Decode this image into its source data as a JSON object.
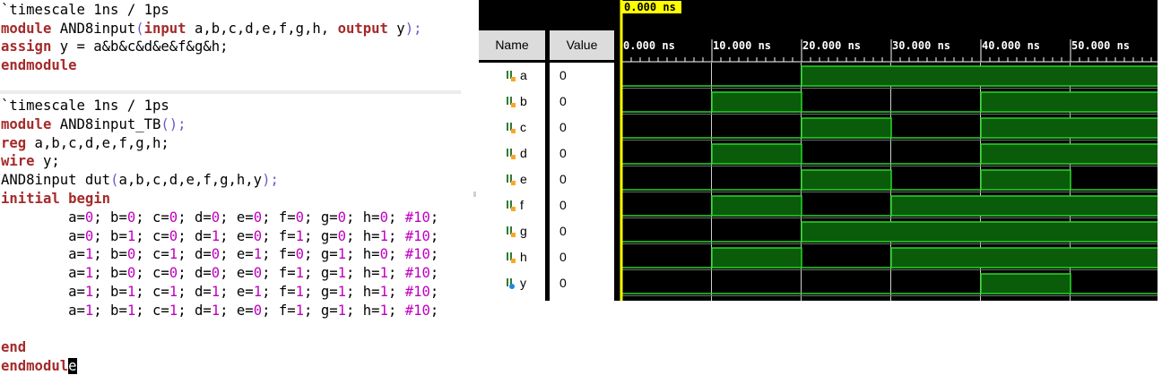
{
  "editor_design": {
    "lines": [
      [
        {
          "t": "`timescale 1ns / 1ps",
          "c": ""
        }
      ],
      [
        {
          "t": "module",
          "c": "kw"
        },
        {
          "t": " AND8input",
          "c": ""
        },
        {
          "t": "(",
          "c": "pu"
        },
        {
          "t": "input",
          "c": "kw"
        },
        {
          "t": " a,b,c,d,e,f,g,h, ",
          "c": ""
        },
        {
          "t": "output",
          "c": "kw"
        },
        {
          "t": " y",
          "c": ""
        },
        {
          "t": ");",
          "c": "pu"
        }
      ],
      [
        {
          "t": "assign",
          "c": "kw"
        },
        {
          "t": " y = a&b&c&d&e&f&g&h;",
          "c": ""
        }
      ],
      [
        {
          "t": "endmodule",
          "c": "kw"
        }
      ]
    ]
  },
  "editor_testbench": {
    "lines": [
      [
        {
          "t": "`timescale 1ns / 1ps",
          "c": ""
        }
      ],
      [
        {
          "t": "module",
          "c": "kw"
        },
        {
          "t": " AND8input_TB",
          "c": ""
        },
        {
          "t": "();",
          "c": "pu"
        }
      ],
      [
        {
          "t": "reg",
          "c": "kw"
        },
        {
          "t": " a,b,c,d,e,f,g,h;",
          "c": ""
        }
      ],
      [
        {
          "t": "wire",
          "c": "kw"
        },
        {
          "t": " y;",
          "c": ""
        }
      ],
      [
        {
          "t": "AND8input dut",
          "c": ""
        },
        {
          "t": "(",
          "c": "pu"
        },
        {
          "t": "a,b,c,d,e,f,g,h,y",
          "c": ""
        },
        {
          "t": ");",
          "c": "pu"
        }
      ],
      [
        {
          "t": "initial begin",
          "c": "kw"
        }
      ],
      [
        {
          "t": "        a=",
          "c": ""
        },
        {
          "t": "0",
          "c": "nm"
        },
        {
          "t": "; b=",
          "c": ""
        },
        {
          "t": "0",
          "c": "nm"
        },
        {
          "t": "; c=",
          "c": ""
        },
        {
          "t": "0",
          "c": "nm"
        },
        {
          "t": "; d=",
          "c": ""
        },
        {
          "t": "0",
          "c": "nm"
        },
        {
          "t": "; e=",
          "c": ""
        },
        {
          "t": "0",
          "c": "nm"
        },
        {
          "t": "; f=",
          "c": ""
        },
        {
          "t": "0",
          "c": "nm"
        },
        {
          "t": "; g=",
          "c": ""
        },
        {
          "t": "0",
          "c": "nm"
        },
        {
          "t": "; h=",
          "c": ""
        },
        {
          "t": "0",
          "c": "nm"
        },
        {
          "t": "; ",
          "c": ""
        },
        {
          "t": "#10",
          "c": "nm"
        },
        {
          "t": ";",
          "c": ""
        }
      ],
      [
        {
          "t": "        a=",
          "c": ""
        },
        {
          "t": "0",
          "c": "nm"
        },
        {
          "t": "; b=",
          "c": ""
        },
        {
          "t": "1",
          "c": "nm"
        },
        {
          "t": "; c=",
          "c": ""
        },
        {
          "t": "0",
          "c": "nm"
        },
        {
          "t": "; d=",
          "c": ""
        },
        {
          "t": "1",
          "c": "nm"
        },
        {
          "t": "; e=",
          "c": ""
        },
        {
          "t": "0",
          "c": "nm"
        },
        {
          "t": "; f=",
          "c": ""
        },
        {
          "t": "1",
          "c": "nm"
        },
        {
          "t": "; g=",
          "c": ""
        },
        {
          "t": "0",
          "c": "nm"
        },
        {
          "t": "; h=",
          "c": ""
        },
        {
          "t": "1",
          "c": "nm"
        },
        {
          "t": "; ",
          "c": ""
        },
        {
          "t": "#10",
          "c": "nm"
        },
        {
          "t": ";",
          "c": ""
        }
      ],
      [
        {
          "t": "        a=",
          "c": ""
        },
        {
          "t": "1",
          "c": "nm"
        },
        {
          "t": "; b=",
          "c": ""
        },
        {
          "t": "0",
          "c": "nm"
        },
        {
          "t": "; c=",
          "c": ""
        },
        {
          "t": "1",
          "c": "nm"
        },
        {
          "t": "; d=",
          "c": ""
        },
        {
          "t": "0",
          "c": "nm"
        },
        {
          "t": "; e=",
          "c": ""
        },
        {
          "t": "1",
          "c": "nm"
        },
        {
          "t": "; f=",
          "c": ""
        },
        {
          "t": "0",
          "c": "nm"
        },
        {
          "t": "; g=",
          "c": ""
        },
        {
          "t": "1",
          "c": "nm"
        },
        {
          "t": "; h=",
          "c": ""
        },
        {
          "t": "0",
          "c": "nm"
        },
        {
          "t": "; ",
          "c": ""
        },
        {
          "t": "#10",
          "c": "nm"
        },
        {
          "t": ";",
          "c": ""
        }
      ],
      [
        {
          "t": "        a=",
          "c": ""
        },
        {
          "t": "1",
          "c": "nm"
        },
        {
          "t": "; b=",
          "c": ""
        },
        {
          "t": "0",
          "c": "nm"
        },
        {
          "t": "; c=",
          "c": ""
        },
        {
          "t": "0",
          "c": "nm"
        },
        {
          "t": "; d=",
          "c": ""
        },
        {
          "t": "0",
          "c": "nm"
        },
        {
          "t": "; e=",
          "c": ""
        },
        {
          "t": "0",
          "c": "nm"
        },
        {
          "t": "; f=",
          "c": ""
        },
        {
          "t": "1",
          "c": "nm"
        },
        {
          "t": "; g=",
          "c": ""
        },
        {
          "t": "1",
          "c": "nm"
        },
        {
          "t": "; h=",
          "c": ""
        },
        {
          "t": "1",
          "c": "nm"
        },
        {
          "t": "; ",
          "c": ""
        },
        {
          "t": "#10",
          "c": "nm"
        },
        {
          "t": ";",
          "c": ""
        }
      ],
      [
        {
          "t": "        a=",
          "c": ""
        },
        {
          "t": "1",
          "c": "nm"
        },
        {
          "t": "; b=",
          "c": ""
        },
        {
          "t": "1",
          "c": "nm"
        },
        {
          "t": "; c=",
          "c": ""
        },
        {
          "t": "1",
          "c": "nm"
        },
        {
          "t": "; d=",
          "c": ""
        },
        {
          "t": "1",
          "c": "nm"
        },
        {
          "t": "; e=",
          "c": ""
        },
        {
          "t": "1",
          "c": "nm"
        },
        {
          "t": "; f=",
          "c": ""
        },
        {
          "t": "1",
          "c": "nm"
        },
        {
          "t": "; g=",
          "c": ""
        },
        {
          "t": "1",
          "c": "nm"
        },
        {
          "t": "; h=",
          "c": ""
        },
        {
          "t": "1",
          "c": "nm"
        },
        {
          "t": "; ",
          "c": ""
        },
        {
          "t": "#10",
          "c": "nm"
        },
        {
          "t": ";",
          "c": ""
        }
      ],
      [
        {
          "t": "        a=",
          "c": ""
        },
        {
          "t": "1",
          "c": "nm"
        },
        {
          "t": "; b=",
          "c": ""
        },
        {
          "t": "1",
          "c": "nm"
        },
        {
          "t": "; c=",
          "c": ""
        },
        {
          "t": "1",
          "c": "nm"
        },
        {
          "t": "; d=",
          "c": ""
        },
        {
          "t": "1",
          "c": "nm"
        },
        {
          "t": "; e=",
          "c": ""
        },
        {
          "t": "0",
          "c": "nm"
        },
        {
          "t": "; f=",
          "c": ""
        },
        {
          "t": "1",
          "c": "nm"
        },
        {
          "t": "; g=",
          "c": ""
        },
        {
          "t": "1",
          "c": "nm"
        },
        {
          "t": "; h=",
          "c": ""
        },
        {
          "t": "1",
          "c": "nm"
        },
        {
          "t": "; ",
          "c": ""
        },
        {
          "t": "#10",
          "c": "nm"
        },
        {
          "t": ";",
          "c": ""
        }
      ],
      [
        {
          "t": "",
          "c": ""
        }
      ],
      [
        {
          "t": "end",
          "c": "kw"
        }
      ],
      [
        {
          "t": "endmodul",
          "c": "kw"
        },
        {
          "t": "e",
          "c": "cursor"
        }
      ]
    ]
  },
  "waveform": {
    "header": {
      "name": "Name",
      "value": "Value"
    },
    "cursor_time": "0.000 ns",
    "time_ticks": [
      "0.000 ns",
      "10.000 ns",
      "20.000 ns",
      "30.000 ns",
      "40.000 ns",
      "50.000 ns"
    ],
    "time_unit": "ns",
    "view_end": 60,
    "signals": [
      {
        "name": "a",
        "value": "0",
        "icon": "bit-signal-icon",
        "levels": [
          0,
          0,
          1,
          1,
          1,
          1
        ]
      },
      {
        "name": "b",
        "value": "0",
        "icon": "bit-signal-icon",
        "levels": [
          0,
          1,
          0,
          0,
          1,
          1
        ]
      },
      {
        "name": "c",
        "value": "0",
        "icon": "bit-signal-icon",
        "levels": [
          0,
          0,
          1,
          0,
          1,
          1
        ]
      },
      {
        "name": "d",
        "value": "0",
        "icon": "bit-signal-icon",
        "levels": [
          0,
          1,
          0,
          0,
          1,
          1
        ]
      },
      {
        "name": "e",
        "value": "0",
        "icon": "bit-signal-icon",
        "levels": [
          0,
          0,
          1,
          0,
          1,
          0
        ]
      },
      {
        "name": "f",
        "value": "0",
        "icon": "bit-signal-icon",
        "levels": [
          0,
          1,
          0,
          1,
          1,
          1
        ]
      },
      {
        "name": "g",
        "value": "0",
        "icon": "bit-signal-icon",
        "levels": [
          0,
          0,
          1,
          1,
          1,
          1
        ]
      },
      {
        "name": "h",
        "value": "0",
        "icon": "bit-signal-icon",
        "levels": [
          0,
          1,
          0,
          1,
          1,
          1
        ]
      },
      {
        "name": "y",
        "value": "0",
        "icon": "output-signal-icon",
        "levels": [
          0,
          0,
          0,
          0,
          1,
          0
        ]
      }
    ],
    "colors": {
      "high_fill": "#0a5c0a",
      "line": "#29d629",
      "cursor": "#ffff00",
      "background": "#000000"
    }
  }
}
